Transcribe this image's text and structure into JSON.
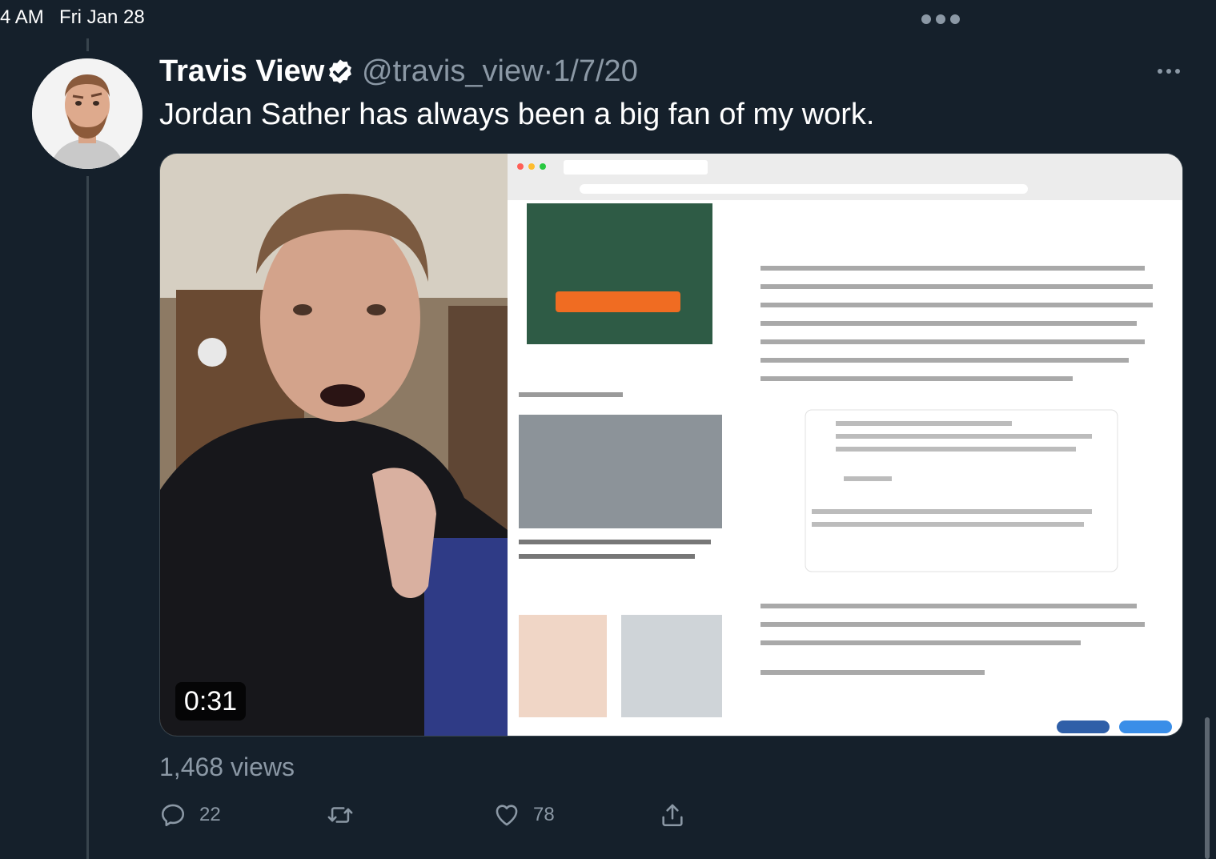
{
  "status_bar": {
    "time": "4 AM",
    "date": "Fri Jan 28"
  },
  "tweet": {
    "author_name": "Travis View",
    "verified": true,
    "handle": "@travis_view",
    "separator": "·",
    "date": "1/7/20",
    "text": "Jordan Sather has always been a big fan of my work.",
    "media": {
      "type": "video",
      "duration": "0:31"
    },
    "views": "1,468 views",
    "actions": {
      "reply_count": "22",
      "retweet_count": "",
      "like_count": "78"
    }
  },
  "colors": {
    "background": "#15202b",
    "secondary_text": "#8b98a5",
    "verified_badge": "#ffffff",
    "divider": "#38444d"
  },
  "icons": [
    "more-options-icon",
    "verified-badge-icon",
    "reply-icon",
    "retweet-icon",
    "like-icon",
    "share-icon"
  ]
}
